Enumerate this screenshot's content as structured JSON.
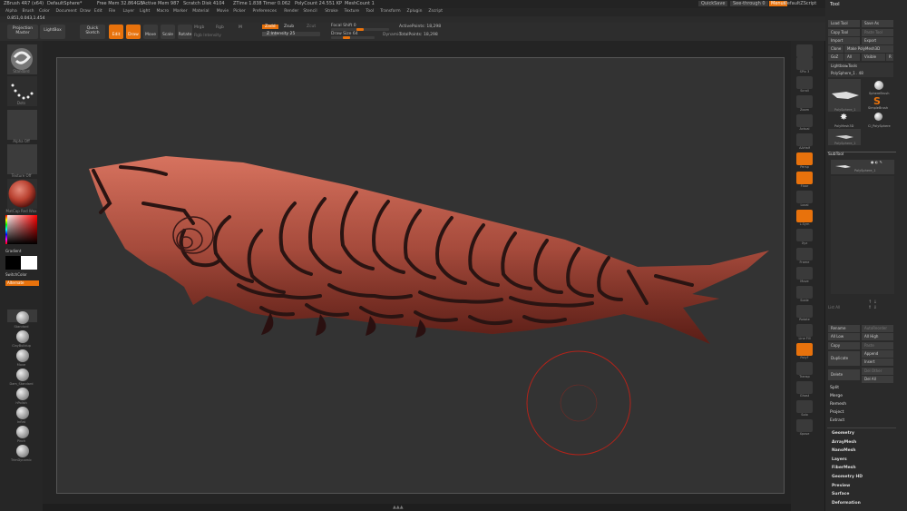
{
  "titlebar": {
    "app": "ZBrush 4R7 (x64)",
    "doc": "DefaultSphere*",
    "free_mem": "Free Mem 32.864GB",
    "active_mem": "Active Mem 987",
    "scratch": "Scratch Disk 4104",
    "ztime": "ZTime 1.838",
    "timer": "Timer 0.062",
    "polycount": "PolyCount 24.551 KP",
    "meshcount": "MeshCount 1",
    "quicksave": "QuickSave",
    "seethrough": "See-through 0",
    "menus": "Menus",
    "defaultzscript": "DefaultZScript"
  },
  "menubar": [
    "Alpha",
    "Brush",
    "Color",
    "Document",
    "Draw",
    "Edit",
    "File",
    "Layer",
    "Light",
    "Macro",
    "Marker",
    "Material",
    "Movie",
    "Picker",
    "Preferences",
    "Render",
    "Stencil",
    "Stroke",
    "Texture",
    "Tool",
    "Transform",
    "Zplugin",
    "Zscript"
  ],
  "coords": "0.851,0.043,1.454",
  "toolbar": {
    "projection_master": "Projection Master",
    "lightbox": "LightBox",
    "quick_sketch": "Quick Sketch",
    "edit": "Edit",
    "draw": "Draw",
    "move": "Move",
    "scale": "Scale",
    "rotate": "Rotate",
    "mrgb": "Mrgb",
    "rgb": "Rgb",
    "m": "M",
    "rgb_intensity": "Rgb Intensity",
    "zadd": "Zadd",
    "zsub": "Zsub",
    "zcut": "Zcut",
    "z_intensity": "Z Intensity 25",
    "focal_shift": "Focal Shift 0",
    "draw_size": "Draw Size 64",
    "dynamic": "Dynamic",
    "active_points": "ActivePoints: 18,298",
    "total_points": "TotalPoints: 18,298"
  },
  "progress": {
    "z_intensity_pct": 25,
    "focal_shift_pct": 50,
    "draw_size_pct": 35
  },
  "left_shelf": {
    "brush_label": "Standard",
    "stroke_label": "Dots",
    "alpha_label": "Alpha Off",
    "texture_label": "Texture Off",
    "material_label": "MatCap Red Wax",
    "gradient": "Gradient",
    "switchcolor": "SwitchColor",
    "alternate": "Alternate",
    "brushes": [
      "Standard",
      "ClayBuildup",
      "Move",
      "Dam_Standard",
      "hPolish",
      "Inflat",
      "Pinch",
      "TrimDynamic"
    ]
  },
  "right_shelf": [
    "BPR",
    "SPix 3",
    "Scroll",
    "Zoom",
    "Actual",
    "AAHalf",
    "Persp",
    "Floor",
    "Local",
    "L.Sym",
    "Xyz",
    "Frame",
    "Move",
    "Scale",
    "Rotate",
    "Line Fill",
    "PolyF",
    "Transp",
    "Ghost",
    "Solo",
    "Xpose"
  ],
  "tool_panel": {
    "title": "Tool",
    "load_tool": "Load Tool",
    "save_as": "Save As",
    "copy_tool": "Copy Tool",
    "paste_tool": "Paste Tool",
    "import": "Import",
    "export": "Export",
    "clone": "Clone",
    "make_polymesh": "Make PolyMesh3D",
    "goz": "GoZ",
    "all": "All",
    "visible": "Visible",
    "r": "R",
    "lightbox_tools": "Lightbox▸Tools",
    "current_tool": "PolySphere_1 . 48",
    "tools": [
      "PolySphere_1",
      "SphereBrush",
      "SimpleBrush",
      "PolyMesh3D",
      "Ci_PolySphere",
      "PolySphere_1"
    ],
    "subtool": "SubTool",
    "subtool_item": "PolySphere_1",
    "list_all": "List All",
    "rename": "Rename",
    "autoreorder": "AutoReorder",
    "all_low": "All Low",
    "all_high": "All High",
    "copy": "Copy",
    "paste": "Paste",
    "duplicate": "Duplicate",
    "append": "Append",
    "insert": "Insert",
    "delete": "Delete",
    "del_other": "Del Other",
    "del_all": "Del All",
    "split": "Split",
    "merge": "Merge",
    "remesh": "Remesh",
    "project": "Project",
    "extract": "Extract",
    "sections": [
      "Geometry",
      "ArrayMesh",
      "NanoMesh",
      "Layers",
      "FiberMesh",
      "Geometry HD",
      "Preview",
      "Surface",
      "Deformation"
    ]
  },
  "colors": {
    "accent": "#e8720c",
    "fish": "#c85a48",
    "brush_ring": "#b3231a"
  }
}
